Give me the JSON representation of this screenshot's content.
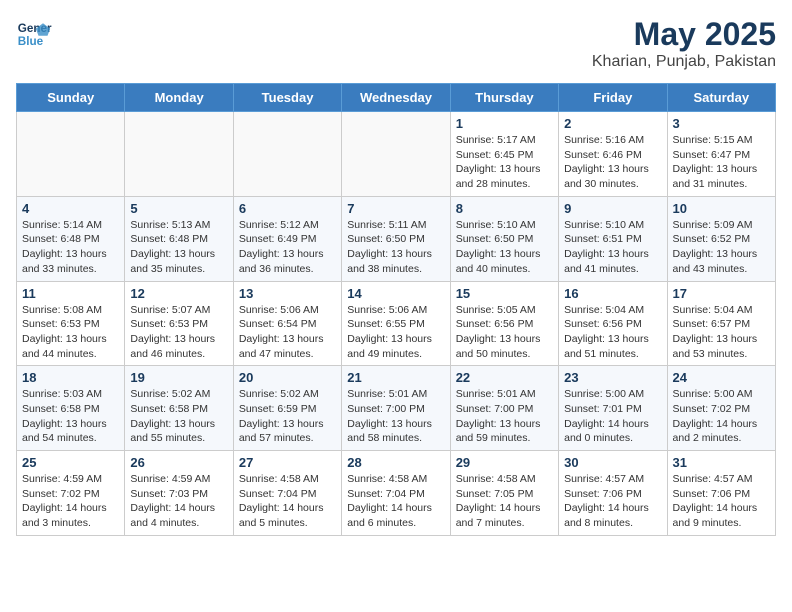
{
  "header": {
    "logo_line1": "General",
    "logo_line2": "Blue",
    "title": "May 2025",
    "subtitle": "Kharian, Punjab, Pakistan"
  },
  "weekdays": [
    "Sunday",
    "Monday",
    "Tuesday",
    "Wednesday",
    "Thursday",
    "Friday",
    "Saturday"
  ],
  "weeks": [
    [
      {
        "day": "",
        "info": ""
      },
      {
        "day": "",
        "info": ""
      },
      {
        "day": "",
        "info": ""
      },
      {
        "day": "",
        "info": ""
      },
      {
        "day": "1",
        "info": "Sunrise: 5:17 AM\nSunset: 6:45 PM\nDaylight: 13 hours\nand 28 minutes."
      },
      {
        "day": "2",
        "info": "Sunrise: 5:16 AM\nSunset: 6:46 PM\nDaylight: 13 hours\nand 30 minutes."
      },
      {
        "day": "3",
        "info": "Sunrise: 5:15 AM\nSunset: 6:47 PM\nDaylight: 13 hours\nand 31 minutes."
      }
    ],
    [
      {
        "day": "4",
        "info": "Sunrise: 5:14 AM\nSunset: 6:48 PM\nDaylight: 13 hours\nand 33 minutes."
      },
      {
        "day": "5",
        "info": "Sunrise: 5:13 AM\nSunset: 6:48 PM\nDaylight: 13 hours\nand 35 minutes."
      },
      {
        "day": "6",
        "info": "Sunrise: 5:12 AM\nSunset: 6:49 PM\nDaylight: 13 hours\nand 36 minutes."
      },
      {
        "day": "7",
        "info": "Sunrise: 5:11 AM\nSunset: 6:50 PM\nDaylight: 13 hours\nand 38 minutes."
      },
      {
        "day": "8",
        "info": "Sunrise: 5:10 AM\nSunset: 6:50 PM\nDaylight: 13 hours\nand 40 minutes."
      },
      {
        "day": "9",
        "info": "Sunrise: 5:10 AM\nSunset: 6:51 PM\nDaylight: 13 hours\nand 41 minutes."
      },
      {
        "day": "10",
        "info": "Sunrise: 5:09 AM\nSunset: 6:52 PM\nDaylight: 13 hours\nand 43 minutes."
      }
    ],
    [
      {
        "day": "11",
        "info": "Sunrise: 5:08 AM\nSunset: 6:53 PM\nDaylight: 13 hours\nand 44 minutes."
      },
      {
        "day": "12",
        "info": "Sunrise: 5:07 AM\nSunset: 6:53 PM\nDaylight: 13 hours\nand 46 minutes."
      },
      {
        "day": "13",
        "info": "Sunrise: 5:06 AM\nSunset: 6:54 PM\nDaylight: 13 hours\nand 47 minutes."
      },
      {
        "day": "14",
        "info": "Sunrise: 5:06 AM\nSunset: 6:55 PM\nDaylight: 13 hours\nand 49 minutes."
      },
      {
        "day": "15",
        "info": "Sunrise: 5:05 AM\nSunset: 6:56 PM\nDaylight: 13 hours\nand 50 minutes."
      },
      {
        "day": "16",
        "info": "Sunrise: 5:04 AM\nSunset: 6:56 PM\nDaylight: 13 hours\nand 51 minutes."
      },
      {
        "day": "17",
        "info": "Sunrise: 5:04 AM\nSunset: 6:57 PM\nDaylight: 13 hours\nand 53 minutes."
      }
    ],
    [
      {
        "day": "18",
        "info": "Sunrise: 5:03 AM\nSunset: 6:58 PM\nDaylight: 13 hours\nand 54 minutes."
      },
      {
        "day": "19",
        "info": "Sunrise: 5:02 AM\nSunset: 6:58 PM\nDaylight: 13 hours\nand 55 minutes."
      },
      {
        "day": "20",
        "info": "Sunrise: 5:02 AM\nSunset: 6:59 PM\nDaylight: 13 hours\nand 57 minutes."
      },
      {
        "day": "21",
        "info": "Sunrise: 5:01 AM\nSunset: 7:00 PM\nDaylight: 13 hours\nand 58 minutes."
      },
      {
        "day": "22",
        "info": "Sunrise: 5:01 AM\nSunset: 7:00 PM\nDaylight: 13 hours\nand 59 minutes."
      },
      {
        "day": "23",
        "info": "Sunrise: 5:00 AM\nSunset: 7:01 PM\nDaylight: 14 hours\nand 0 minutes."
      },
      {
        "day": "24",
        "info": "Sunrise: 5:00 AM\nSunset: 7:02 PM\nDaylight: 14 hours\nand 2 minutes."
      }
    ],
    [
      {
        "day": "25",
        "info": "Sunrise: 4:59 AM\nSunset: 7:02 PM\nDaylight: 14 hours\nand 3 minutes."
      },
      {
        "day": "26",
        "info": "Sunrise: 4:59 AM\nSunset: 7:03 PM\nDaylight: 14 hours\nand 4 minutes."
      },
      {
        "day": "27",
        "info": "Sunrise: 4:58 AM\nSunset: 7:04 PM\nDaylight: 14 hours\nand 5 minutes."
      },
      {
        "day": "28",
        "info": "Sunrise: 4:58 AM\nSunset: 7:04 PM\nDaylight: 14 hours\nand 6 minutes."
      },
      {
        "day": "29",
        "info": "Sunrise: 4:58 AM\nSunset: 7:05 PM\nDaylight: 14 hours\nand 7 minutes."
      },
      {
        "day": "30",
        "info": "Sunrise: 4:57 AM\nSunset: 7:06 PM\nDaylight: 14 hours\nand 8 minutes."
      },
      {
        "day": "31",
        "info": "Sunrise: 4:57 AM\nSunset: 7:06 PM\nDaylight: 14 hours\nand 9 minutes."
      }
    ]
  ]
}
